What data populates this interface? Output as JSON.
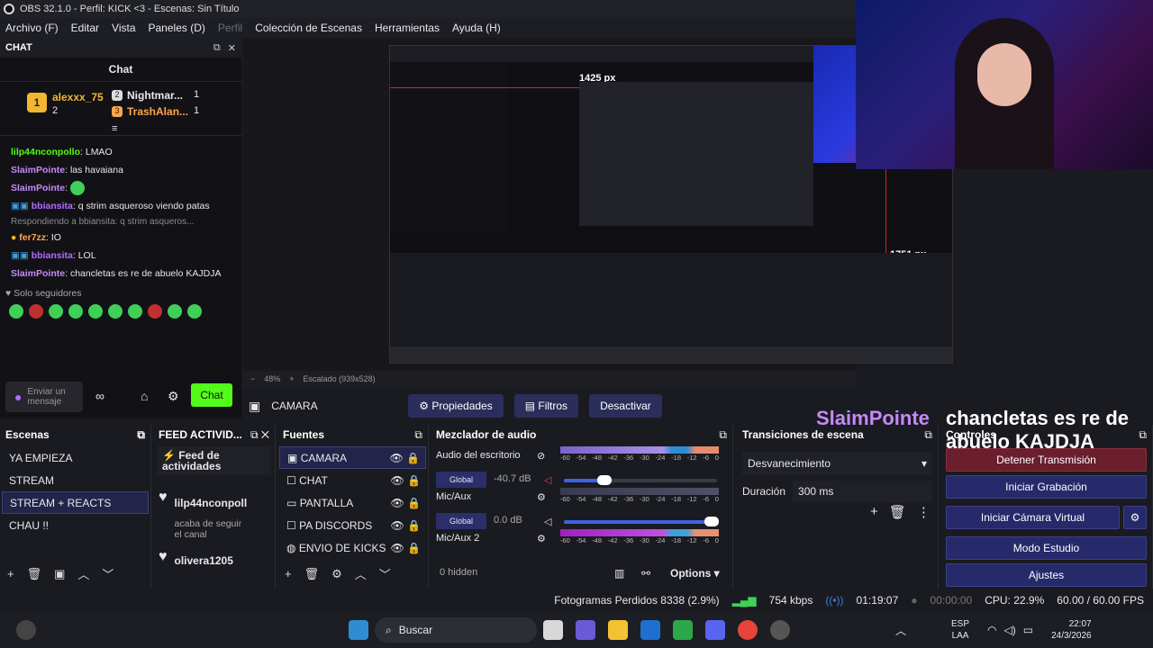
{
  "window": {
    "title": "OBS 32.1.0 - Perfil: KICK <3 - Escenas: Sin Título"
  },
  "menu": [
    "Archivo (F)",
    "Editar",
    "Vista",
    "Paneles (D)",
    "Perfil",
    "Colección de Escenas",
    "Herramientas",
    "Ayuda (H)"
  ],
  "chat_dock": {
    "label": "CHAT",
    "title": "Chat",
    "leaderboard": [
      {
        "rank": "1",
        "name": "alexxx_75",
        "count": "2"
      },
      {
        "rank": "2",
        "name": "Nightmar...",
        "count": "1"
      },
      {
        "rank": "3",
        "name": "TrashAlan...",
        "count": "1"
      }
    ],
    "messages": [
      {
        "user": "lilp44nconpollo",
        "text": ": LMAO",
        "color": "green"
      },
      {
        "user": "SlaimPointe",
        "text": ": las havaiana",
        "color": "pink"
      },
      {
        "user": "SlaimPointe",
        "text": ":",
        "color": "pink"
      },
      {
        "user": "bbiansita",
        "text": ": q strim asqueroso viendo patas",
        "color": "purple"
      },
      {
        "user": "fer7zz",
        "text": ": IO",
        "color": "orange"
      },
      {
        "user": "bbiansita",
        "text": ": LOL",
        "color": "purple"
      },
      {
        "user": "SlaimPointe",
        "text": ": chancletas es re de abuelo KAJDJA",
        "color": "pink"
      }
    ],
    "reply_text": "Respondiendo a bbiansita: q strim asqueros...",
    "followers_only": "Solo seguidores",
    "input_placeholder": "Enviar un mensaje",
    "infinity": "∞",
    "send_label": "Chat"
  },
  "zoom": {
    "minus": "−",
    "percent": "48%",
    "plus": "+",
    "scaled": "Escalado (939x528)"
  },
  "source_bar": {
    "selected_source": "CAMARA",
    "properties": "Propiedades",
    "filters": "Filtros",
    "deactivate": "Desactivar"
  },
  "overlay": {
    "name": "SlaimPointe",
    "message": "chancletas es re de abuelo KAJDJA"
  },
  "scenes": {
    "title": "Escenas",
    "items": [
      "YA EMPIEZA",
      "STREAM",
      "STREAM + REACTS",
      "CHAU !!"
    ],
    "selected_index": 2
  },
  "activity": {
    "title": "FEED ACTIVID...",
    "header": "Feed de actividades",
    "events": [
      {
        "user": "lilp44nconpoll",
        "detail": "acaba de seguir el canal"
      },
      {
        "user": "olivera1205",
        "detail": ""
      }
    ]
  },
  "sources": {
    "title": "Fuentes",
    "items": [
      {
        "name": "CAMARA",
        "icon": "camera-icon"
      },
      {
        "name": "CHAT",
        "icon": "window-icon"
      },
      {
        "name": "PANTALLA",
        "icon": "monitor-icon"
      },
      {
        "name": "PA DISCORDS",
        "icon": "window-icon"
      },
      {
        "name": "ENVIO DE KICKS",
        "icon": "globe-icon"
      }
    ]
  },
  "mixer": {
    "title": "Mezclador de audio",
    "ticks": [
      "-60",
      "-54",
      "-48",
      "-42",
      "-36",
      "-30",
      "-24",
      "-18",
      "-12",
      "-6",
      "0"
    ],
    "channels": [
      {
        "name": "Audio del escritorio",
        "badge": "Global",
        "db": "-40.7 dB",
        "level": 0.3,
        "muted": true
      },
      {
        "name": "Mic/Aux",
        "badge": "Global",
        "db": "0.0 dB",
        "level": 1.0,
        "muted": false
      },
      {
        "name": "Mic/Aux 2",
        "badge": "",
        "db": "",
        "level": 0.0,
        "muted": false
      }
    ],
    "hidden": "0 hidden",
    "options": "Options"
  },
  "transitions": {
    "title": "Transiciones de escena",
    "type": "Desvanecimiento",
    "duration_label": "Duración",
    "duration": "300 ms"
  },
  "controls": {
    "title": "Controles",
    "buttons": [
      "Detener Transmisión",
      "Iniciar Grabación",
      "Iniciar Cámara Virtual",
      "Modo Estudio",
      "Ajustes"
    ]
  },
  "status": {
    "frames": "Fotogramas Perdidos 8338 (2.9%)",
    "bitrate": "754 kbps",
    "stream_time": "01:19:07",
    "rec_time": "00:00:00",
    "cpu": "CPU: 22.9%",
    "fps": "60.00 / 60.00 FPS"
  },
  "taskbar": {
    "search": "Buscar",
    "lang1": "ESP",
    "lang2": "LAA",
    "time": "22:07",
    "date": "24/3/2026"
  },
  "preview_inner": {
    "px_label_1": "1425 px",
    "px_label_2": "1751 px"
  },
  "colors": {
    "accent": "#53fc18",
    "obs_blue": "#26296a",
    "bg": "#1a1b20"
  }
}
